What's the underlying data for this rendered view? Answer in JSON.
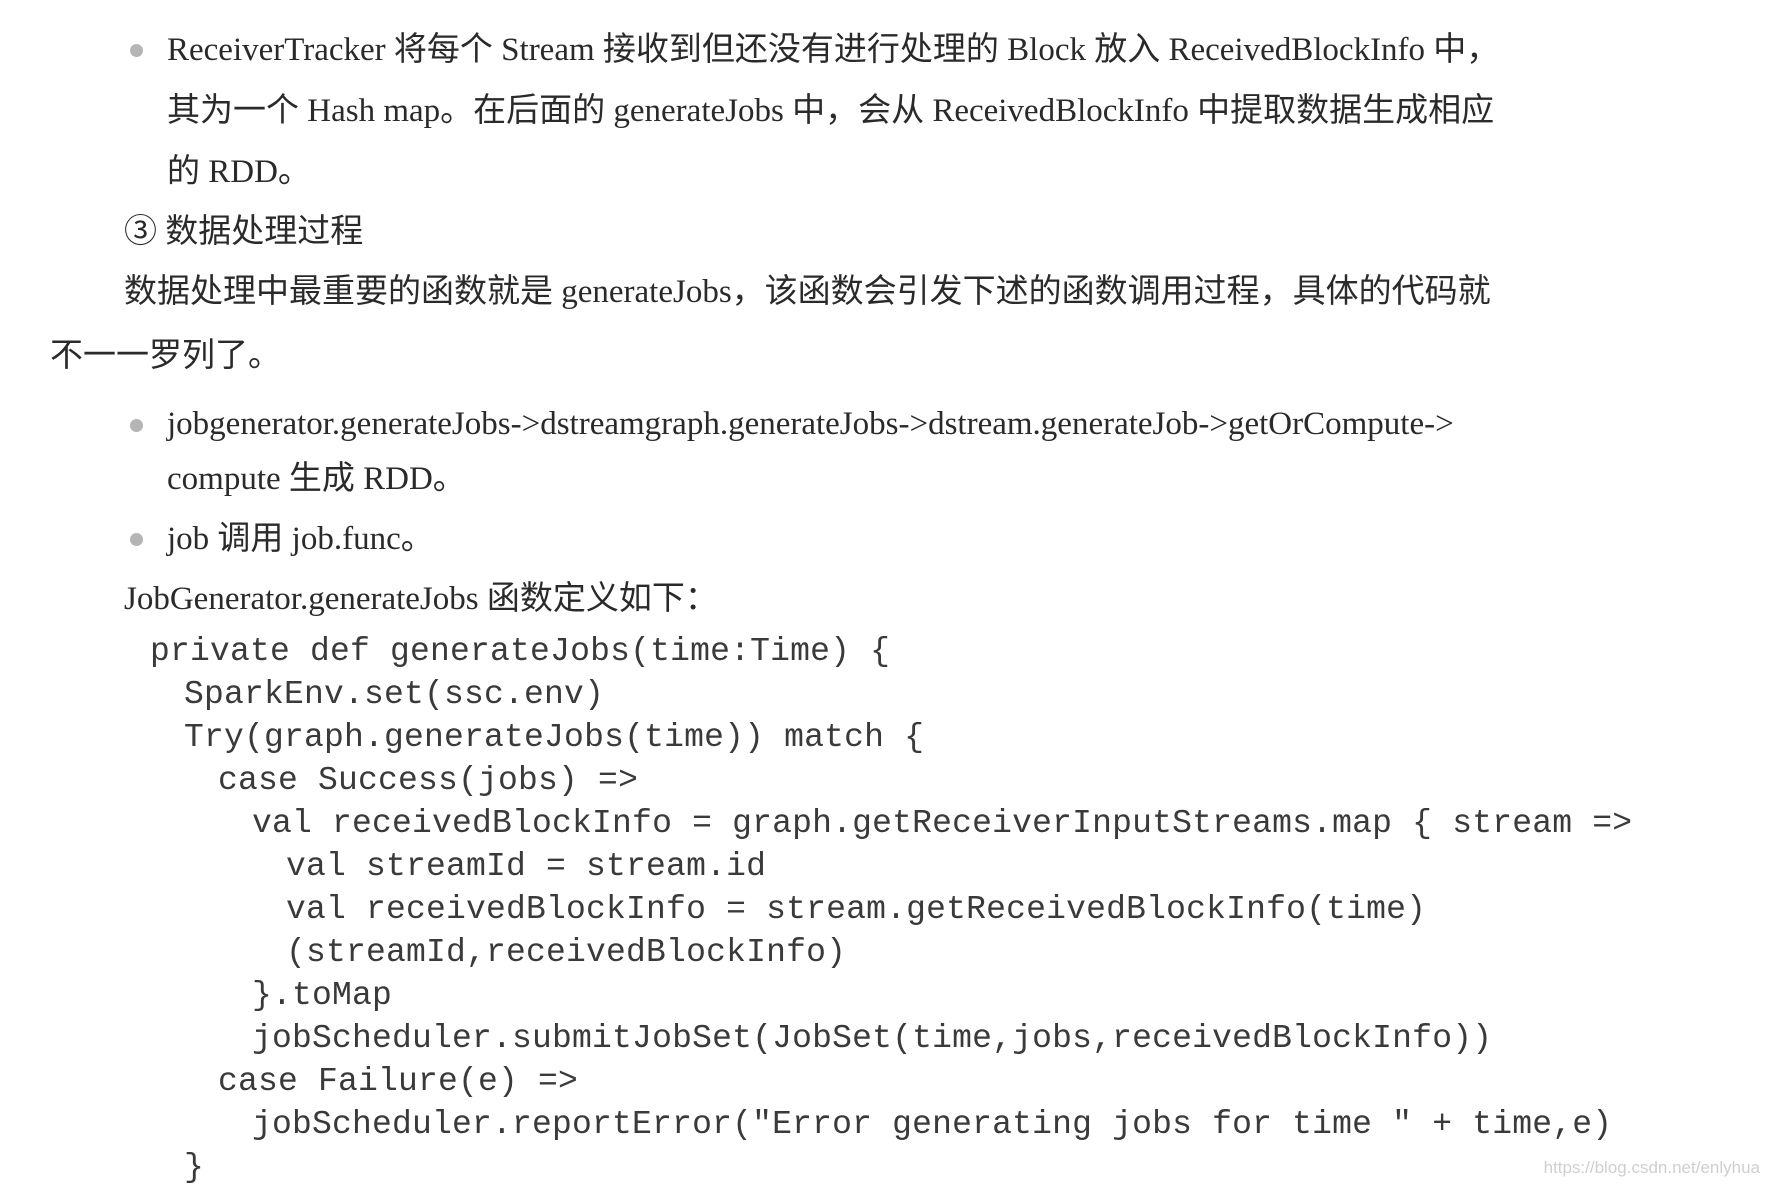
{
  "bullets": [
    {
      "lines": [
        "ReceiverTracker 将每个 Stream 接收到但还没有进行处理的 Block 放入 ReceivedBlockInfo 中，",
        "其为一个 Hash map。在后面的 generateJobs 中，会从 ReceivedBlockInfo 中提取数据生成相应",
        "的 RDD。"
      ]
    },
    {
      "lines": [
        "jobgenerator.generateJobs->dstreamgraph.generateJobs->dstream.generateJob->getOrCompute->",
        "compute 生成 RDD。"
      ]
    },
    {
      "lines": [
        "job 调用 job.func。"
      ]
    }
  ],
  "heading": "③ 数据处理过程",
  "paragraph": [
    "数据处理中最重要的函数就是 generateJobs，该函数会引发下述的函数调用过程，具体的代码就",
    "不一一罗列了。"
  ],
  "code_intro": "JobGenerator.generateJobs 函数定义如下：",
  "code": [
    {
      "indent": 0,
      "text": "private def generateJobs(time:Time) {"
    },
    {
      "indent": 1,
      "text": "SparkEnv.set(ssc.env)"
    },
    {
      "indent": 1,
      "text": "Try(graph.generateJobs(time)) match {"
    },
    {
      "indent": 2,
      "text": "case Success(jobs) =>"
    },
    {
      "indent": 3,
      "text": "val receivedBlockInfo = graph.getReceiverInputStreams.map { stream =>"
    },
    {
      "indent": 4,
      "text": "val streamId = stream.id"
    },
    {
      "indent": 4,
      "text": "val receivedBlockInfo = stream.getReceivedBlockInfo(time)"
    },
    {
      "indent": 4,
      "text": "(streamId,receivedBlockInfo)"
    },
    {
      "indent": 3,
      "text": "}.toMap"
    },
    {
      "indent": 3,
      "text": "jobScheduler.submitJobSet(JobSet(time,jobs,receivedBlockInfo))"
    },
    {
      "indent": 2,
      "text": "case Failure(e) =>"
    },
    {
      "indent": 3,
      "text": "jobScheduler.reportError(\"Error generating jobs for time \" + time,e)"
    },
    {
      "indent": 1,
      "text": "}"
    }
  ],
  "watermark": "https://blog.csdn.net/enlyhua"
}
